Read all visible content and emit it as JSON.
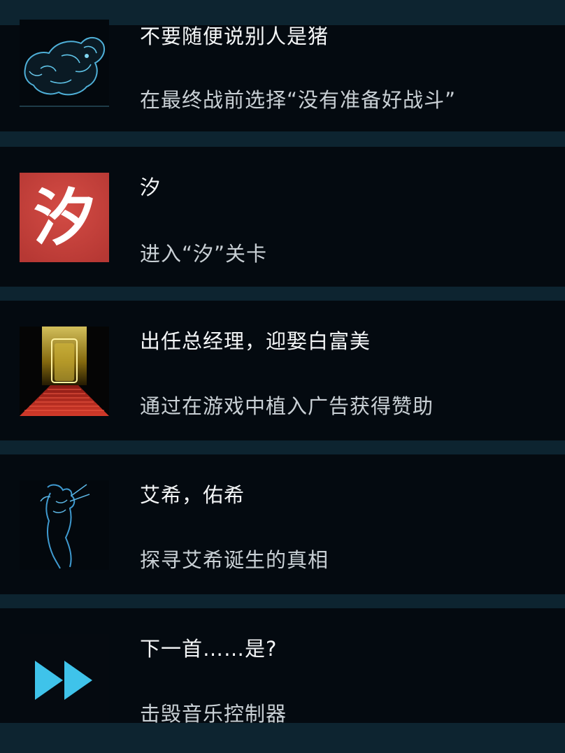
{
  "achievements": [
    {
      "title": "不要随便说别人是猪",
      "description": "在最终战前选择“没有准备好战斗”",
      "icon": "pig-icon"
    },
    {
      "title": "汐",
      "description": "进入“汐”关卡",
      "icon": "xi-character-icon",
      "icon_glyph": "汐"
    },
    {
      "title": "出任总经理，迎娶白富美",
      "description": "通过在游戏中植入广告获得赞助",
      "icon": "golden-door-icon"
    },
    {
      "title": "艾希，佑希",
      "description": "探寻艾希诞生的真相",
      "icon": "figure-icon"
    },
    {
      "title": "下一首……是?",
      "description": "击毁音乐控制器",
      "icon": "fast-forward-icon"
    }
  ],
  "colors": {
    "background": "#0b1d27",
    "card": "#040a10",
    "xi_icon_red": "#c8403b",
    "fast_forward_blue": "#3fc3ea"
  }
}
